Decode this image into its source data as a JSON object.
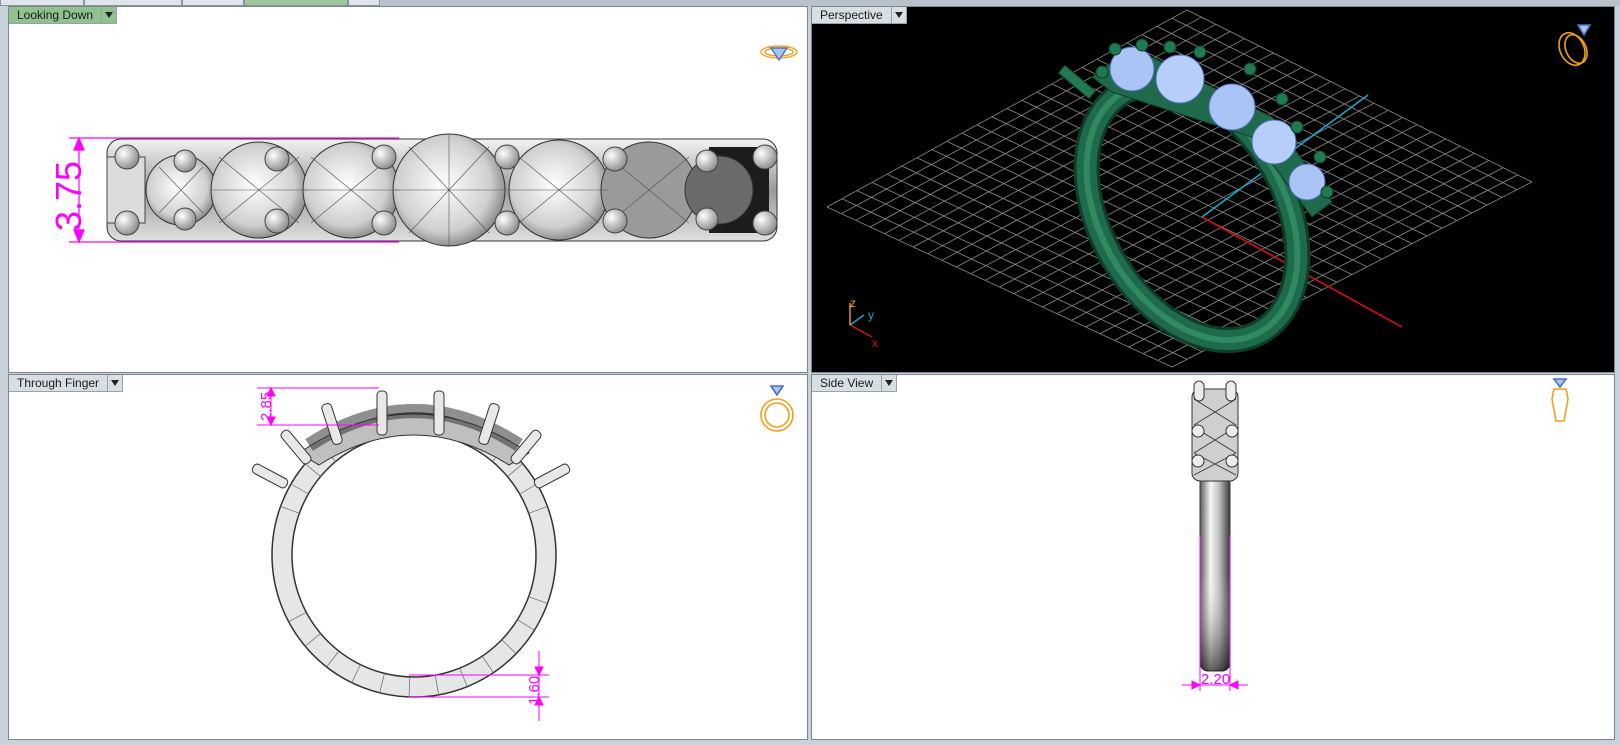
{
  "viewports": {
    "top_left": {
      "label": "Looking Down",
      "active": true
    },
    "top_right": {
      "label": "Perspective"
    },
    "bottom_left": {
      "label": "Through Finger"
    },
    "bottom_right": {
      "label": "Side View"
    }
  },
  "dimensions": {
    "width_top": "3.75",
    "height_front": "2.85",
    "shank_front": "1.60",
    "shank_side": "2.20"
  },
  "axes": {
    "x": "x",
    "y": "y",
    "z": "z"
  },
  "colors": {
    "dimension": "#ff00ff",
    "active_tab": "#8fc28f",
    "ring_metal": "#1f6a4a",
    "stone": "#a9c4f5",
    "axis_x": "#d01010",
    "axis_y": "#18a8c8",
    "grid": "#8a8a8a",
    "nav_icon": "#f0a020"
  }
}
